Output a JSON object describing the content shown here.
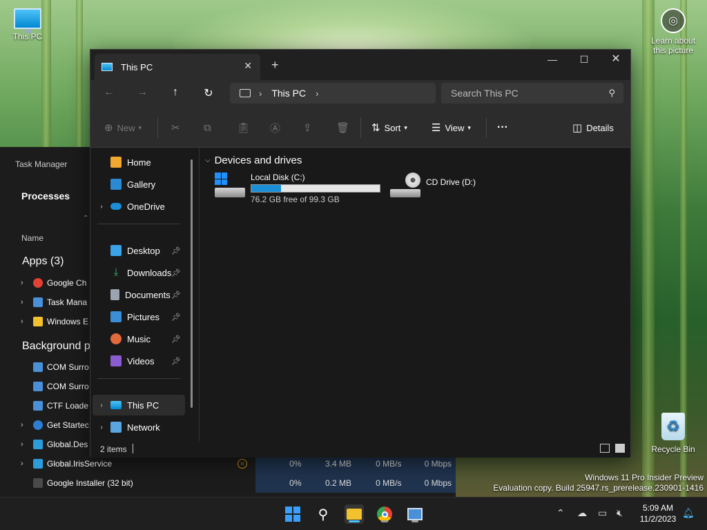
{
  "desktop": {
    "this_pc_label": "This PC",
    "learn_label_1": "Learn about",
    "learn_label_2": "this picture",
    "recycle_bin_label": "Recycle Bin",
    "watermark_line1": "Windows 11 Pro Insider Preview",
    "watermark_line2": "Evaluation copy. Build 25947.rs_prerelease.230901-1416"
  },
  "task_manager": {
    "title": "Task Manager",
    "processes": "Processes",
    "name_col": "Name",
    "apps_section": "Apps (3)",
    "apps": [
      {
        "name": "Google Ch",
        "color": "#e34133"
      },
      {
        "name": "Task Mana",
        "color": "#4a90d9"
      },
      {
        "name": "Windows E",
        "color": "#f2c12e"
      }
    ],
    "bg_section": "Background p",
    "bg_processes": [
      {
        "name": "COM Surro",
        "color": "#4a90d9"
      },
      {
        "name": "COM Surro",
        "color": "#4a90d9"
      },
      {
        "name": "CTF Loade",
        "color": "#4a90d9"
      },
      {
        "name": "Get Startec",
        "color": "#2d7dd2"
      }
    ],
    "bottom_rows": [
      {
        "name": "Global.Des",
        "cpu": "",
        "mem": "",
        "disk": "",
        "net": "",
        "color": "#2d9cdb"
      },
      {
        "name": "Global.IrisService",
        "cpu": "0%",
        "mem": "3.4 MB",
        "disk": "0 MB/s",
        "net": "0 Mbps",
        "color": "#2d9cdb"
      },
      {
        "name": "Google Installer (32 bit)",
        "cpu": "0%",
        "mem": "0.2 MB",
        "disk": "0 MB/s",
        "net": "0 Mbps",
        "color": "#4a4a4a"
      }
    ]
  },
  "explorer": {
    "tab_title": "This PC",
    "breadcrumb": "This PC",
    "search_placeholder": "Search This PC",
    "cmd": {
      "new": "New",
      "sort": "Sort",
      "view": "View",
      "more": "···",
      "details": "Details"
    },
    "sidebar": {
      "quick": [
        "Home",
        "Gallery",
        "OneDrive"
      ],
      "pinned": [
        "Desktop",
        "Downloads",
        "Documents",
        "Pictures",
        "Music",
        "Videos"
      ],
      "bottom": [
        "This PC",
        "Network"
      ]
    },
    "group_header": "Devices and drives",
    "drives": [
      {
        "name": "Local Disk (C:)",
        "free_text": "76.2 GB free of 99.3 GB",
        "used_fraction": 0.233
      },
      {
        "name": "CD Drive (D:)"
      }
    ],
    "status_items": "2 items"
  },
  "taskbar": {
    "time": "5:09 AM",
    "date": "11/2/2023"
  }
}
